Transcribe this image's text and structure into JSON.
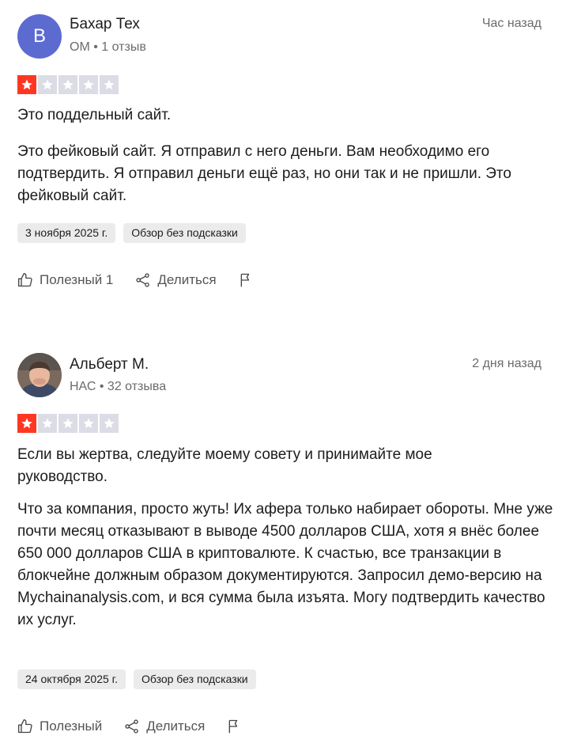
{
  "reviews": [
    {
      "author": "Бахар Тех",
      "avatar_letter": "B",
      "meta": "OM • 1 отзыв",
      "time": "Час назад",
      "rating": 1,
      "title": "Это поддельный сайт.",
      "body": "Это фейковый сайт. Я отправил с него деньги. Вам необходимо его подтвердить. Я отправил деньги ещё раз, но они так и не пришли. Это фейковый сайт.",
      "date_tag": "3 ноября 2025 г.",
      "unprompted_tag": "Обзор без подсказки",
      "useful_label": "Полезный 1",
      "share_label": "Делиться"
    },
    {
      "author": "Альберт М.",
      "meta": "НАС • 32 отзыва",
      "time": "2 дня назад",
      "rating": 1,
      "title": "Если вы жертва, следуйте моему совету и принимайте мое руководство.",
      "body": "Что за компания, просто жуть! Их афера только набирает обороты. Мне уже почти месяц отказывают в выводе 4500 долларов США, хотя я внёс более 650 000 долларов США в криптовалюте. К счастью, все транзакции в блокчейне должным образом документируются. Запросил демо-версию на Mychainanalysis.com, и вся сумма была изъята. Могу подтвердить качество их услуг.",
      "date_tag": "24 октября 2025 г.",
      "unprompted_tag": "Обзор без подсказки",
      "useful_label": "Полезный",
      "share_label": "Делиться"
    }
  ],
  "icons": {
    "thumbs_up": "thumbs-up-icon",
    "share": "share-icon",
    "flag": "flag-icon",
    "star": "star-icon"
  },
  "colors": {
    "star_on": "#ff3722",
    "star_off": "#dcdce6",
    "avatar_bg": "#5b6bd0"
  }
}
